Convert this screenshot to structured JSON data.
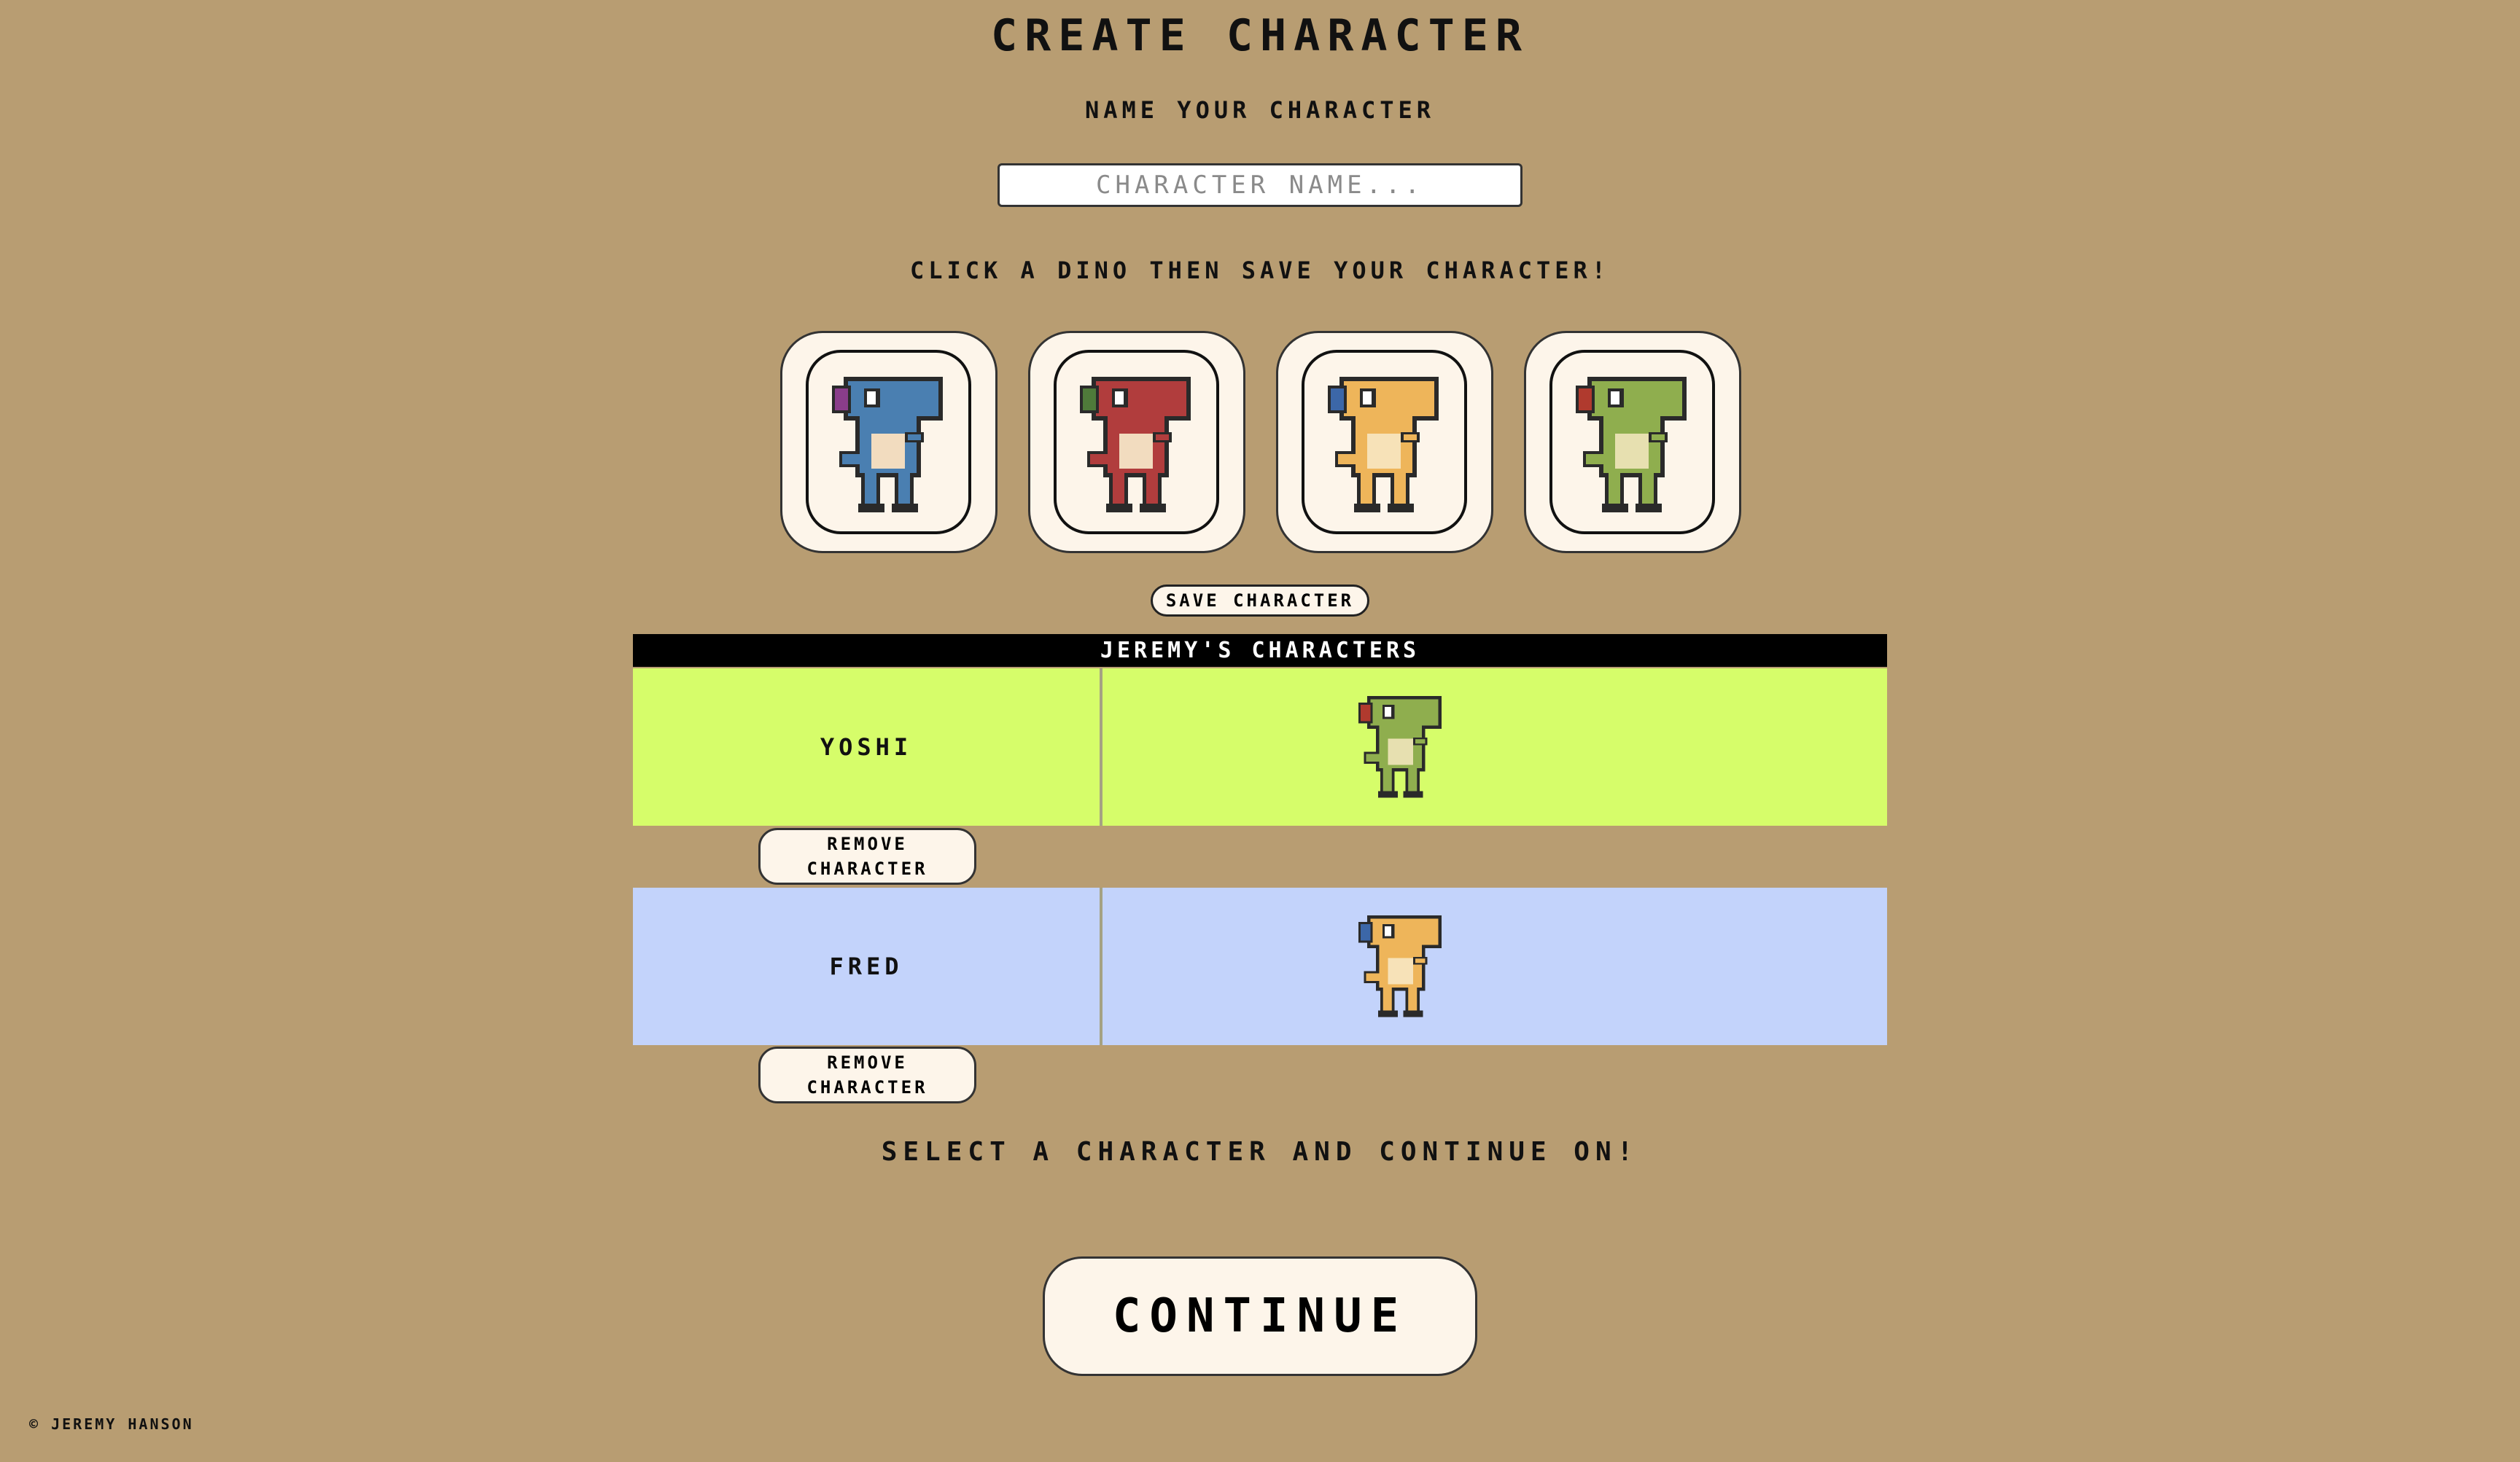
{
  "page": {
    "title": "Create Character",
    "name_label": "Name Your Character",
    "name_input": {
      "placeholder": "Character Name...",
      "value": ""
    },
    "instructions": "Click a dino then save your character!",
    "save_button": "Save Character"
  },
  "dino_options": [
    {
      "color": "blue",
      "body": "#4a7fb1",
      "belly": "#f2dcbf",
      "accent": "#8a3d8a"
    },
    {
      "color": "red",
      "body": "#b13d3d",
      "belly": "#f2dcbf",
      "accent": "#4f7a3a"
    },
    {
      "color": "yellow",
      "body": "#eeb55a",
      "belly": "#f7e2b8",
      "accent": "#3c67a8"
    },
    {
      "color": "green",
      "body": "#8fae4e",
      "belly": "#e7e0b0",
      "accent": "#b03a2e"
    }
  ],
  "characters_table": {
    "header": "Jeremy's Characters",
    "rows": [
      {
        "name": "Yoshi",
        "dino": "green",
        "row_color": "#d6fd6a",
        "remove_label": "Remove Character"
      },
      {
        "name": "Fred",
        "dino": "yellow",
        "row_color": "#c3d3fb",
        "remove_label": "Remove Character"
      }
    ]
  },
  "select_text": "Select a character and continue on!",
  "continue_button": "Continue",
  "footer": "© Jeremy Hanson"
}
